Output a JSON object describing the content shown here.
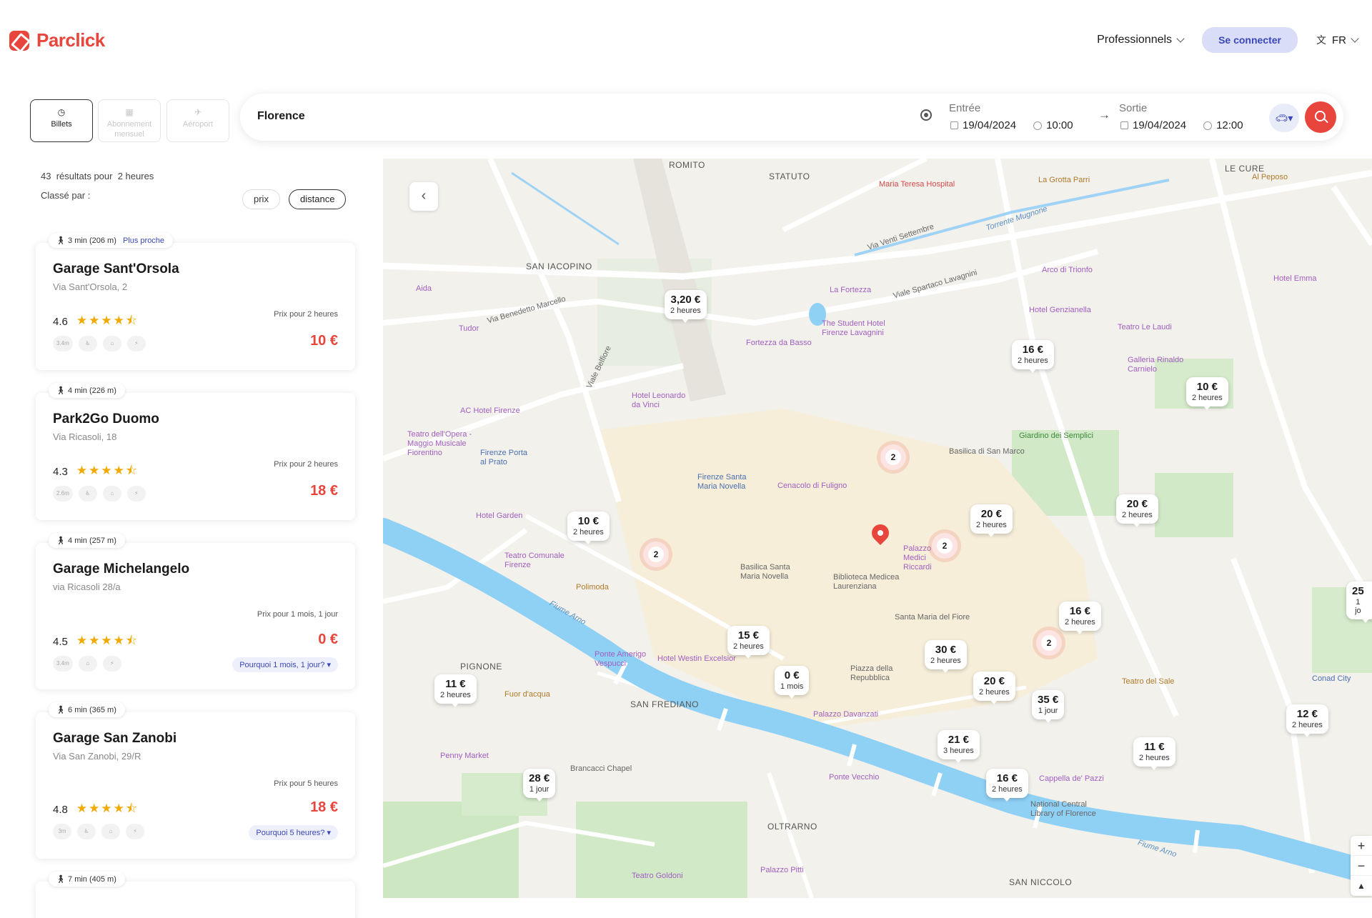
{
  "brand": {
    "name": "Parclick",
    "color": "#e8453c"
  },
  "nav": {
    "professionals": "Professionnels",
    "login": "Se connecter",
    "lang": "FR"
  },
  "tabs": [
    {
      "label": "Billets",
      "icon": "clock-icon"
    },
    {
      "label": "Abonnement mensuel",
      "icon": "calendar-icon"
    },
    {
      "label": "Aéroport",
      "icon": "plane-icon"
    }
  ],
  "search": {
    "city": "Florence",
    "entry_label": "Entrée",
    "entry_date": "19/04/2024",
    "entry_time": "10:00",
    "exit_label": "Sortie",
    "exit_date": "19/04/2024",
    "exit_time": "12:00"
  },
  "results": {
    "count": "43",
    "count_suffix": "résultats pour",
    "duration": "2 heures",
    "sort_label": "Classé par :",
    "sort_price": "prix",
    "sort_distance": "distance"
  },
  "cards": [
    {
      "walk": "3 min (206 m)",
      "tag": "Plus proche",
      "name": "Garage Sant'Orsola",
      "address": "Via Sant'Orsola, 2",
      "rating": "4.6",
      "price_label": "Prix pour 2 heures",
      "price": "10 €",
      "features": [
        "3.4m",
        "",
        "",
        ""
      ]
    },
    {
      "walk": "4 min (226 m)",
      "name": "Park2Go Duomo",
      "address": "Via Ricasoli, 18",
      "rating": "4.3",
      "price_label": "Prix pour 2 heures",
      "price": "18 €",
      "features": [
        "2.6m",
        "",
        "",
        ""
      ]
    },
    {
      "walk": "4 min (257 m)",
      "name": "Garage Michelangelo",
      "address": "via Ricasoli 28/a",
      "rating": "4.5",
      "price_label": "Prix pour 1 mois, 1 jour",
      "price": "0 €",
      "features": [
        "3.4m",
        "",
        ""
      ],
      "why": "Pourquoi  1 mois, 1 jour?"
    },
    {
      "walk": "6 min (365 m)",
      "name": "Garage San Zanobi",
      "address": "Via San Zanobi, 29/R",
      "rating": "4.8",
      "price_label": "Prix pour 5 heures",
      "price": "18 €",
      "features": [
        "3m",
        "",
        "",
        ""
      ],
      "why": "Pourquoi  5 heures?"
    },
    {
      "walk": "7 min (405 m)"
    }
  ],
  "map": {
    "pins": [
      {
        "price": "3,20 €",
        "dur": "2 heures"
      },
      {
        "price": "16 €",
        "dur": "2 heures"
      },
      {
        "price": "10 €",
        "dur": "2 heures"
      },
      {
        "price": "10 €",
        "dur": "2 heures"
      },
      {
        "price": "20 €",
        "dur": "2 heures"
      },
      {
        "price": "20 €",
        "dur": "2 heures"
      },
      {
        "price": "16 €",
        "dur": "2 heures"
      },
      {
        "price": "15 €",
        "dur": "2 heures"
      },
      {
        "price": "30 €",
        "dur": "2 heures"
      },
      {
        "price": "0 €",
        "dur": "1 mois"
      },
      {
        "price": "11 €",
        "dur": "2 heures"
      },
      {
        "price": "20 €",
        "dur": "2 heures"
      },
      {
        "price": "35 €",
        "dur": "1 jour"
      },
      {
        "price": "21 €",
        "dur": "3 heures"
      },
      {
        "price": "12 €",
        "dur": "2 heures"
      },
      {
        "price": "11 €",
        "dur": "2 heures"
      },
      {
        "price": "28 €",
        "dur": "1 jour"
      },
      {
        "price": "16 €",
        "dur": "2 heures"
      },
      {
        "price": "25",
        "dur": "1 jo"
      }
    ],
    "clusters": [
      "2",
      "2",
      "2",
      "2"
    ],
    "labels": {
      "romito": "ROMITO",
      "statuto": "STATUTO",
      "le_cure": "LE CURE",
      "san_iacopino": "SAN IACOPINO",
      "pignone": "PIGNONE",
      "san_frediano": "SAN FREDIANO",
      "oltrarno": "OLTRARNO",
      "san_niccolo": "SAN NICCOLO",
      "hospital": "Maria Teresa Hospital",
      "fortezza": "La Fortezza",
      "fortezza_basso": "Fortezza da Basso",
      "student_hotel": "The Student Hotel Firenze Lavagnini",
      "santa_maria": "Firenze Santa Maria Novella",
      "basilica_smn": "Basilica Santa Maria Novella",
      "medicea": "Biblioteca Medicea Laurenziana",
      "duomo": "Santa Maria del Fiore",
      "repubblica": "Piazza della Repubblica",
      "davanzati": "Palazzo Davanzati",
      "ponte_vecchio": "Ponte Vecchio",
      "pitti": "Palazzo Pitti",
      "national_library": "National Central Library of Florence",
      "semplici": "Giardino dei Semplici",
      "san_marco": "Basilica di San Marco",
      "medici": "Palazzo Medici Riccardi",
      "arno": "Fiume Arno",
      "spartaco": "Viale Spartaco Lavagnini",
      "venti_settembre": "Via Venti Settembre",
      "mugnone": "Torrente Mugnone",
      "belfiore": "Viale Belfiore",
      "marcello": "Via Benedetto Marcello",
      "cenacolo": "Cenacolo di Fuligno",
      "hotel_leonardo": "Hotel Leonardo da Vinci",
      "ac_hotel": "AC Hotel Firenze",
      "penny": "Penny Market",
      "brancacci": "Brancacci Chapel",
      "polimoda": "Polimoda",
      "tudor": "Tudor",
      "aida": "Aida",
      "teatro_sale": "Teatro del Sale",
      "cappella_pazzi": "Cappella de' Pazzi",
      "hotel_emma": "Hotel Emma",
      "conad": "Conad City",
      "grotta": "La Grotta Parri",
      "peposo": "Al Peposo",
      "westin": "Hotel Westin Excelsior",
      "teatro_goldoni": "Teatro Goldoni",
      "fuor": "Fuor d'acqua",
      "garden": "Hotel Garden",
      "teatro_opera": "Teatro dell'Opera - Maggio Musicale Fiorentino",
      "porta_prato": "Firenze Porta al Prato",
      "teatro_comunale": "Teatro Comunale Firenze",
      "ponte_amerigo": "Ponte Amerigo Vespucci",
      "genzianella": "Hotel Genzianella",
      "arco": "Arco di Trionfo",
      "galleria_carnielo": "Galleria Rinaldo Carnielo",
      "teatro_laudi": "Teatro Le Laudi"
    },
    "zoom_in": "+",
    "zoom_out": "−"
  }
}
